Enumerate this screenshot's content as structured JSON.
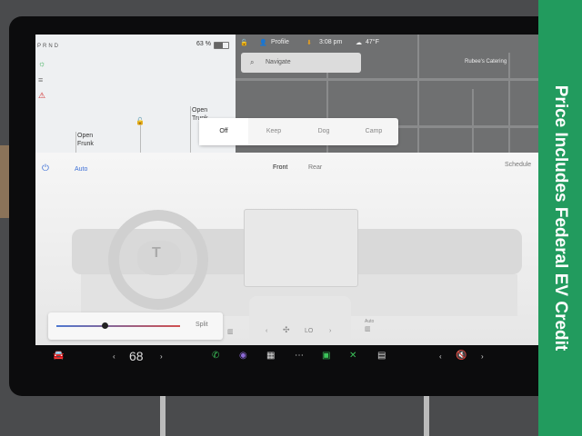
{
  "status": {
    "gear": "PRND",
    "battery": "63 %",
    "battery_level": 0.63
  },
  "topbar": {
    "profile": "Profile",
    "time": "3:08 pm",
    "temp": "47°F"
  },
  "trunk": {
    "frunk": "Open\nFrunk",
    "trunk": "Open\nTrunk"
  },
  "nav": {
    "placeholder": "Navigate",
    "poi": "Rubee's Catering"
  },
  "climate_modes": [
    "Off",
    "Keep",
    "Dog",
    "Camp"
  ],
  "climate": {
    "auto": "Auto",
    "front": "Front",
    "rear": "Rear",
    "schedule": "Schedule",
    "split": "Split",
    "fan": "LO",
    "auto_small": "Auto"
  },
  "taskbar": {
    "temp": "68"
  },
  "banner": {
    "text": "Price Includes Federal EV Credit"
  },
  "colors": {
    "accent": "#3d6fd6",
    "banner": "#229b5e"
  },
  "icons": [
    "car-icon",
    "phone-icon",
    "camera-icon",
    "media-icon",
    "more-icon",
    "calendar-icon",
    "shuffle-icon",
    "energy-icon",
    "volume-mute-icon",
    "lock-icon",
    "user-icon",
    "warning-icon",
    "cloud-icon",
    "power-icon",
    "search-icon",
    "fan-icon"
  ]
}
